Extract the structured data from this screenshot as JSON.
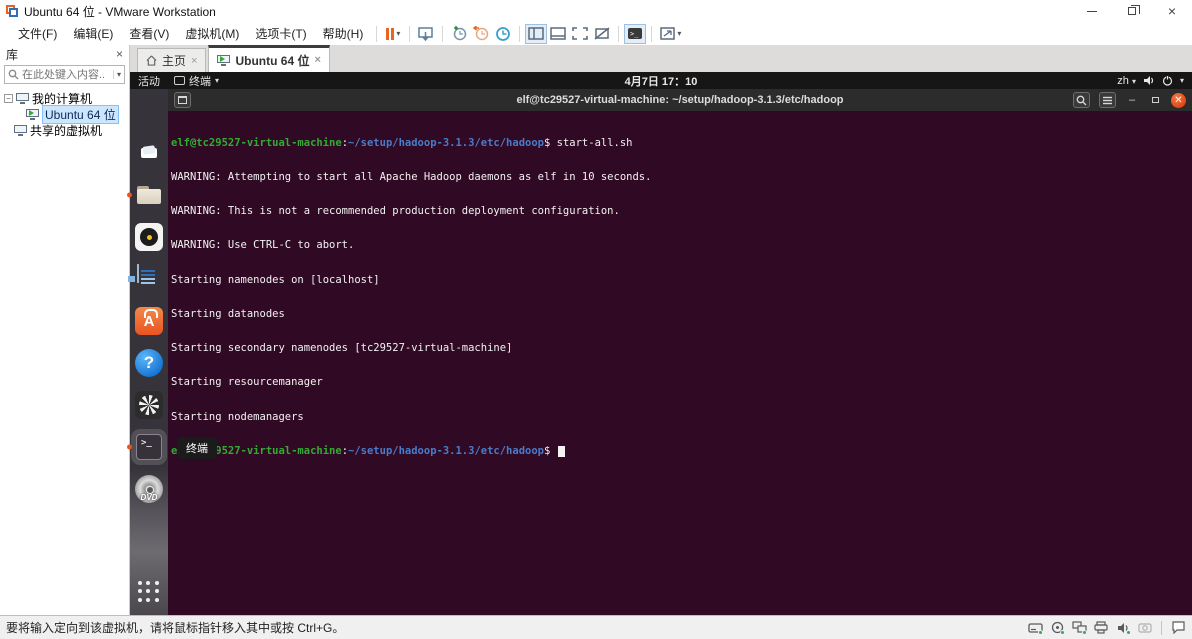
{
  "window": {
    "title": "Ubuntu 64 位 - VMware Workstation"
  },
  "menu": {
    "items": [
      "文件(F)",
      "编辑(E)",
      "查看(V)",
      "虚拟机(M)",
      "选项卡(T)",
      "帮助(H)"
    ]
  },
  "tabs": {
    "home": "主页",
    "vm": "Ubuntu 64 位"
  },
  "library": {
    "header": "库",
    "search_placeholder": "在此处键入内容...",
    "tree": {
      "my_computer": "我的计算机",
      "vm": "Ubuntu 64 位",
      "shared": "共享的虚拟机"
    }
  },
  "ubuntu": {
    "topbar": {
      "activities": "活动",
      "app_menu": "终端",
      "clock": "4月7日 17：10",
      "input_method": "zh"
    },
    "dock": {
      "items": [
        "firefox",
        "thunderbird",
        "files",
        "rhythmbox",
        "libreoffice-writer",
        "ubuntu-software",
        "help",
        "screenshot-tool",
        "terminal",
        "dvd",
        "show-applications"
      ],
      "tooltip": "终端"
    },
    "terminal": {
      "title": "elf@tc29527-virtual-machine: ~/setup/hadoop-3.1.3/etc/hadoop",
      "prompt": {
        "user": "elf@tc29527-virtual-machine",
        "colon": ":",
        "path": "~/setup/hadoop-3.1.3/etc/hadoop",
        "dollar": "$"
      },
      "command": " start-all.sh",
      "output": [
        "WARNING: Attempting to start all Apache Hadoop daemons as elf in 10 seconds.",
        "WARNING: This is not a recommended production deployment configuration.",
        "WARNING: Use CTRL-C to abort.",
        "Starting namenodes on [localhost]",
        "Starting datanodes",
        "Starting secondary namenodes [tc29527-virtual-machine]",
        "Starting resourcemanager",
        "Starting nodemanagers"
      ]
    }
  },
  "statusbar": {
    "message": "要将输入定向到该虚拟机，请将鼠标指针移入其中或按 Ctrl+G。"
  },
  "colors": {
    "terminal_bg": "#300a24",
    "prompt_green": "#33ab33",
    "path_blue": "#4b7bc8",
    "ubuntu_orange": "#e95420",
    "topbar_bg": "#161616"
  }
}
